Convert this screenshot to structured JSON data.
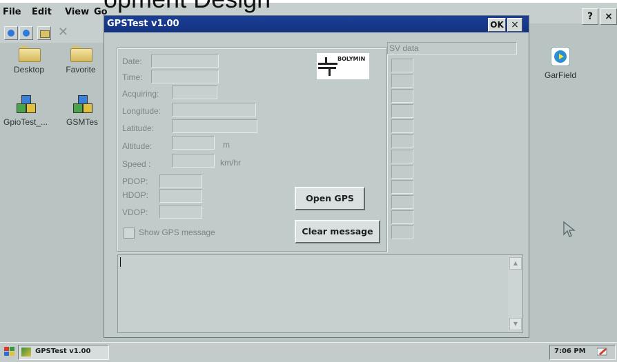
{
  "overlay_text": "opment Design",
  "menu": {
    "file": "File",
    "edit": "Edit",
    "view": "View",
    "go": "Go"
  },
  "top_right_buttons": {
    "help": "?",
    "close": "×"
  },
  "desktop_icons": [
    {
      "label": "Desktop",
      "icon": "folder-icon"
    },
    {
      "label": "Favorite",
      "icon": "folder-icon"
    },
    {
      "label": "GpioTest_...",
      "icon": "app-cubes-icon"
    },
    {
      "label": "GSMTes",
      "icon": "app-cubes-icon"
    },
    {
      "label": "GarField",
      "icon": "garfield-app-icon"
    }
  ],
  "window": {
    "title": "GPSTest v1.00",
    "ok_label": "OK",
    "close_label": "×",
    "logo_text": "BOLYMIN",
    "fields": {
      "date_label": "Date:",
      "time_label": "Time:",
      "acquiring_label": "Acquiring:",
      "longitude_label": "Longitude:",
      "latitude_label": "Latitude:",
      "altitude_label": "Altitude:",
      "altitude_unit": "m",
      "speed_label": "Speed :",
      "speed_unit": "km/hr",
      "pdop_label": "PDOP:",
      "hdop_label": "HDOP:",
      "vdop_label": "VDOP:"
    },
    "checkbox_label": "Show GPS message",
    "open_gps_label": "Open GPS",
    "clear_message_label": "Clear message",
    "sv_data_label": "SV data",
    "sv_cells": 12,
    "message_text": ""
  },
  "taskbar": {
    "task_label": "GPSTest v1.00",
    "clock": "7:06 PM"
  },
  "colors": {
    "title_bar": "#1b3f96",
    "desktop": "#b9c4c2",
    "window_bg": "#c1cbca"
  }
}
